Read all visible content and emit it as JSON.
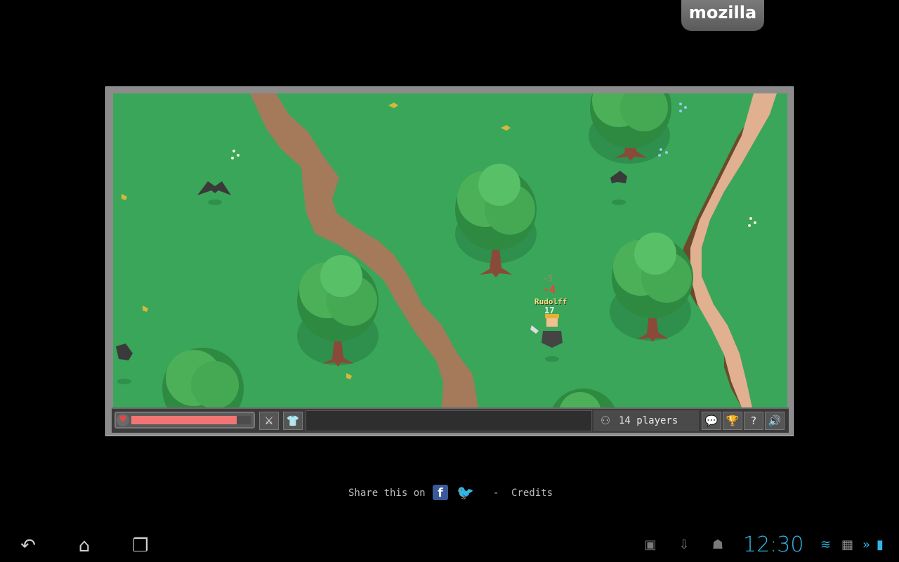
{
  "browser": {
    "logo": "mozilla"
  },
  "game": {
    "player_name": "Rudolff",
    "damage_top": "-5",
    "damage_main": "-4",
    "player_level": "17",
    "health_fraction": 0.88,
    "player_count": "14 players",
    "hud_icons": [
      "heart-icon",
      "sword-icon",
      "armor-icon",
      "players-icon",
      "chat-icon",
      "achievements-icon",
      "help-icon",
      "sound-icon"
    ]
  },
  "share": {
    "label": "Share this on",
    "separator": "-",
    "credits": "Credits"
  },
  "android": {
    "nav": {
      "back": "↶",
      "home": "⌂",
      "recents": "❐"
    },
    "time": "12:30",
    "notif_icons": [
      "gallery-icon",
      "download-icon",
      "android-icon"
    ]
  }
}
